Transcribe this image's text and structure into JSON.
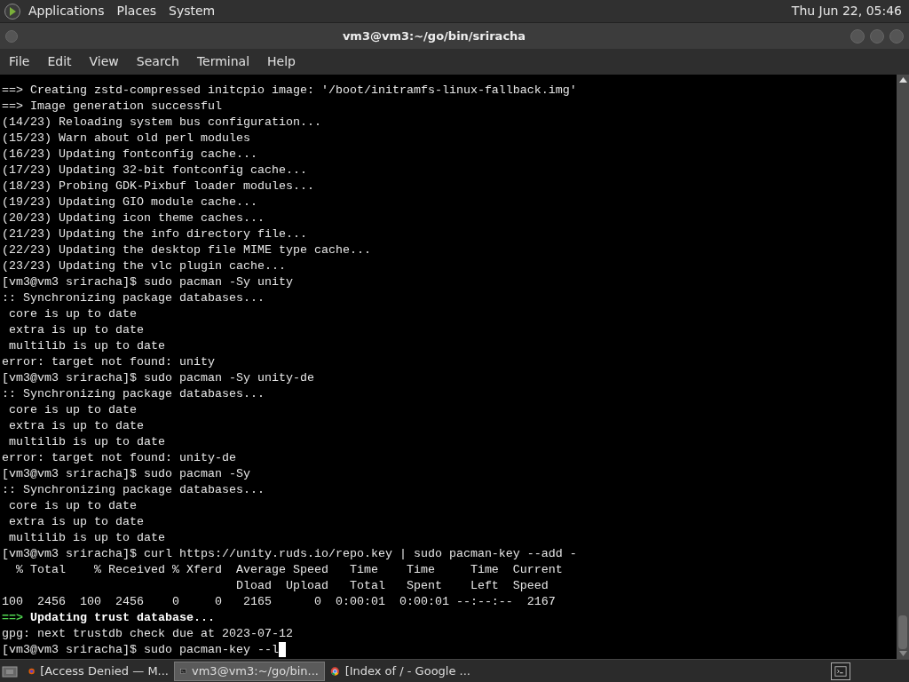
{
  "top_panel": {
    "menus": [
      "Applications",
      "Places",
      "System"
    ],
    "clock": "Thu Jun 22, 05:46"
  },
  "window": {
    "title": "vm3@vm3:~/go/bin/sriracha"
  },
  "menubar": [
    "File",
    "Edit",
    "View",
    "Search",
    "Terminal",
    "Help"
  ],
  "terminal": {
    "lines": [
      {
        "kind": "plain",
        "text": "==> Creating zstd-compressed initcpio image: '/boot/initramfs-linux-fallback.img'"
      },
      {
        "kind": "plain",
        "text": "==> Image generation successful"
      },
      {
        "kind": "plain",
        "text": "(14/23) Reloading system bus configuration..."
      },
      {
        "kind": "plain",
        "text": "(15/23) Warn about old perl modules"
      },
      {
        "kind": "plain",
        "text": "(16/23) Updating fontconfig cache..."
      },
      {
        "kind": "plain",
        "text": "(17/23) Updating 32-bit fontconfig cache..."
      },
      {
        "kind": "plain",
        "text": "(18/23) Probing GDK-Pixbuf loader modules..."
      },
      {
        "kind": "plain",
        "text": "(19/23) Updating GIO module cache..."
      },
      {
        "kind": "plain",
        "text": "(20/23) Updating icon theme caches..."
      },
      {
        "kind": "plain",
        "text": "(21/23) Updating the info directory file..."
      },
      {
        "kind": "plain",
        "text": "(22/23) Updating the desktop file MIME type cache..."
      },
      {
        "kind": "plain",
        "text": "(23/23) Updating the vlc plugin cache..."
      },
      {
        "kind": "plain",
        "text": "[vm3@vm3 sriracha]$ sudo pacman -Sy unity"
      },
      {
        "kind": "plain",
        "text": ":: Synchronizing package databases..."
      },
      {
        "kind": "plain",
        "text": " core is up to date"
      },
      {
        "kind": "plain",
        "text": " extra is up to date"
      },
      {
        "kind": "plain",
        "text": " multilib is up to date"
      },
      {
        "kind": "plain",
        "text": "error: target not found: unity"
      },
      {
        "kind": "plain",
        "text": "[vm3@vm3 sriracha]$ sudo pacman -Sy unity-de"
      },
      {
        "kind": "plain",
        "text": ":: Synchronizing package databases..."
      },
      {
        "kind": "plain",
        "text": " core is up to date"
      },
      {
        "kind": "plain",
        "text": " extra is up to date"
      },
      {
        "kind": "plain",
        "text": " multilib is up to date"
      },
      {
        "kind": "plain",
        "text": "error: target not found: unity-de"
      },
      {
        "kind": "plain",
        "text": "[vm3@vm3 sriracha]$ sudo pacman -Sy"
      },
      {
        "kind": "plain",
        "text": ":: Synchronizing package databases..."
      },
      {
        "kind": "plain",
        "text": " core is up to date"
      },
      {
        "kind": "plain",
        "text": " extra is up to date"
      },
      {
        "kind": "plain",
        "text": " multilib is up to date"
      },
      {
        "kind": "plain",
        "text": "[vm3@vm3 sriracha]$ curl https://unity.ruds.io/repo.key | sudo pacman-key --add -"
      },
      {
        "kind": "plain",
        "text": "  % Total    % Received % Xferd  Average Speed   Time    Time     Time  Current"
      },
      {
        "kind": "plain",
        "text": "                                 Dload  Upload   Total   Spent    Left  Speed"
      },
      {
        "kind": "plain",
        "text": "100  2456  100  2456    0     0   2165      0  0:00:01  0:00:01 --:--:--  2167"
      },
      {
        "kind": "step",
        "marker": "==>",
        "text": "Updating trust database..."
      },
      {
        "kind": "plain",
        "text": "gpg: next trustdb check due at 2023-07-12"
      },
      {
        "kind": "input",
        "text": "[vm3@vm3 sriracha]$ sudo pacman-key --l"
      }
    ]
  },
  "taskbar": {
    "items": [
      {
        "label": "[Access Denied — M...",
        "selected": false,
        "kind": "browser"
      },
      {
        "label": "vm3@vm3:~/go/bin...",
        "selected": true,
        "kind": "terminal"
      },
      {
        "label": "[Index of / - Google ...",
        "selected": false,
        "kind": "chrome"
      }
    ]
  }
}
